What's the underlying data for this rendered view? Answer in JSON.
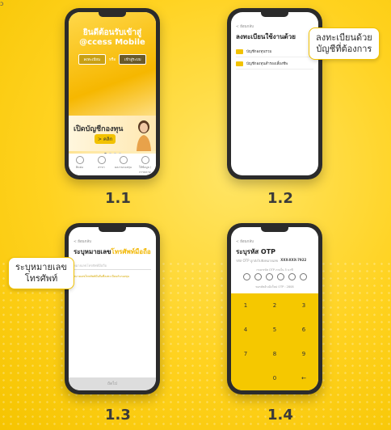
{
  "corner_mark": "ɔ",
  "steps": [
    {
      "label": "1.1",
      "screen": {
        "title_line1": "ยินดีต้อนรับเข้าสู่",
        "title_line2": "@ccess Mobile",
        "register_button": "ลงทะเบียน",
        "or_text": "หรือ",
        "login_button": "เข้าสู่ระบบ",
        "banner_text": "เปิดบัญชีกองทุน",
        "banner_click": "> คลิก",
        "nav": [
          {
            "label": "ติดต่อ",
            "icon": "phone-icon"
          },
          {
            "label": "สาขา",
            "icon": "location-icon"
          },
          {
            "label": "ผลงานกองทุน",
            "icon": "chart-icon"
          },
          {
            "label": "ให้ข้อมูล / การตลาด",
            "icon": "info-icon"
          }
        ]
      }
    },
    {
      "label": "1.2",
      "screen": {
        "back": "< ย้อนกลับ",
        "title": "ลงทะเบียนใช้งานด้วย",
        "options": [
          "บัญชีกองทุนรวม",
          "บัญชีกองทุนสำรองเลี้ยงชีพ"
        ]
      },
      "callout": {
        "line1": "ลงทะเบียนด้วย",
        "line2": "บัญชีที่ต้องการ"
      }
    },
    {
      "label": "1.3",
      "screen": {
        "back": "< ย้อนกลับ",
        "title_prefix": "ระบุหมายเลข",
        "title_highlight": "โทรศัพท์มือถือ",
        "input_placeholder": "หมายเลขโทรศัพท์มือถือ",
        "hint": "หมายเลขโทรศัพท์มือถือที่ลงทะเบียนกับกองทุน",
        "next_button": "ถัดไป"
      },
      "callout": {
        "line1": "ระบุหมายเลข",
        "line2": "โทรศัพท์"
      }
    },
    {
      "label": "1.4",
      "screen": {
        "back": "< ย้อนกลับ",
        "title": "ระบุรหัส OTP",
        "sent_to_label": "รหัส OTP ถูกส่งไปยังหมายเลข",
        "phone_masked": "XXX-XXX-7922",
        "otp_prompt": "กรอกรหัส OTP ภายใน 5 นาที",
        "ref_text": "ขอรหัสอ้างอิงใหม่ OTP : 2808",
        "keys": [
          "1",
          "2",
          "3",
          "4",
          "5",
          "6",
          "7",
          "8",
          "9",
          "",
          "0",
          "←"
        ]
      }
    }
  ],
  "colors": {
    "brand_yellow": "#f5c800",
    "phone_frame": "#2b2b2b"
  }
}
